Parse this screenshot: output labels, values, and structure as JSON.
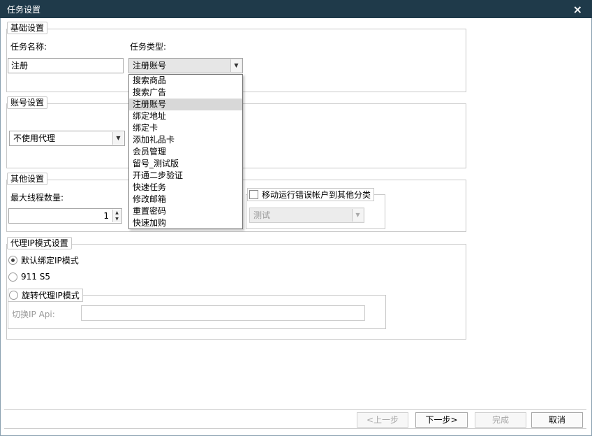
{
  "window": {
    "title": "任务设置",
    "close_icon": "×"
  },
  "basic": {
    "legend": "基础设置",
    "task_name_label": "任务名称:",
    "task_name_value": "注册",
    "task_type_label": "任务类型:",
    "task_type_value": "注册账号",
    "task_type_options": [
      "搜索商品",
      "搜索广告",
      "注册账号",
      "绑定地址",
      "绑定卡",
      "添加礼品卡",
      "会员管理",
      "留号_测试版",
      "开通二步验证",
      "快速任务",
      "修改邮箱",
      "重置密码",
      "快速加购"
    ],
    "task_type_selected_index": 2
  },
  "account": {
    "legend": "账号设置",
    "proxy_value": "不使用代理"
  },
  "other": {
    "legend": "其他设置",
    "max_threads_label": "最大线程数量:",
    "max_threads_value": "1",
    "move_error_label": "移动运行错误帐户到其他分类",
    "move_error_checked": false,
    "category_value": "测试"
  },
  "proxy_ip": {
    "legend": "代理IP模式设置",
    "default_mode_label": "默认绑定IP模式",
    "default_mode_selected": true,
    "s5_label": "911 S5",
    "rotate_mode_label": "旋转代理IP模式",
    "switch_api_label": "切换IP Api:",
    "switch_api_value": ""
  },
  "footer": {
    "prev_label": "<上一步",
    "next_label": "下一步>",
    "finish_label": "完成",
    "cancel_label": "取消"
  }
}
